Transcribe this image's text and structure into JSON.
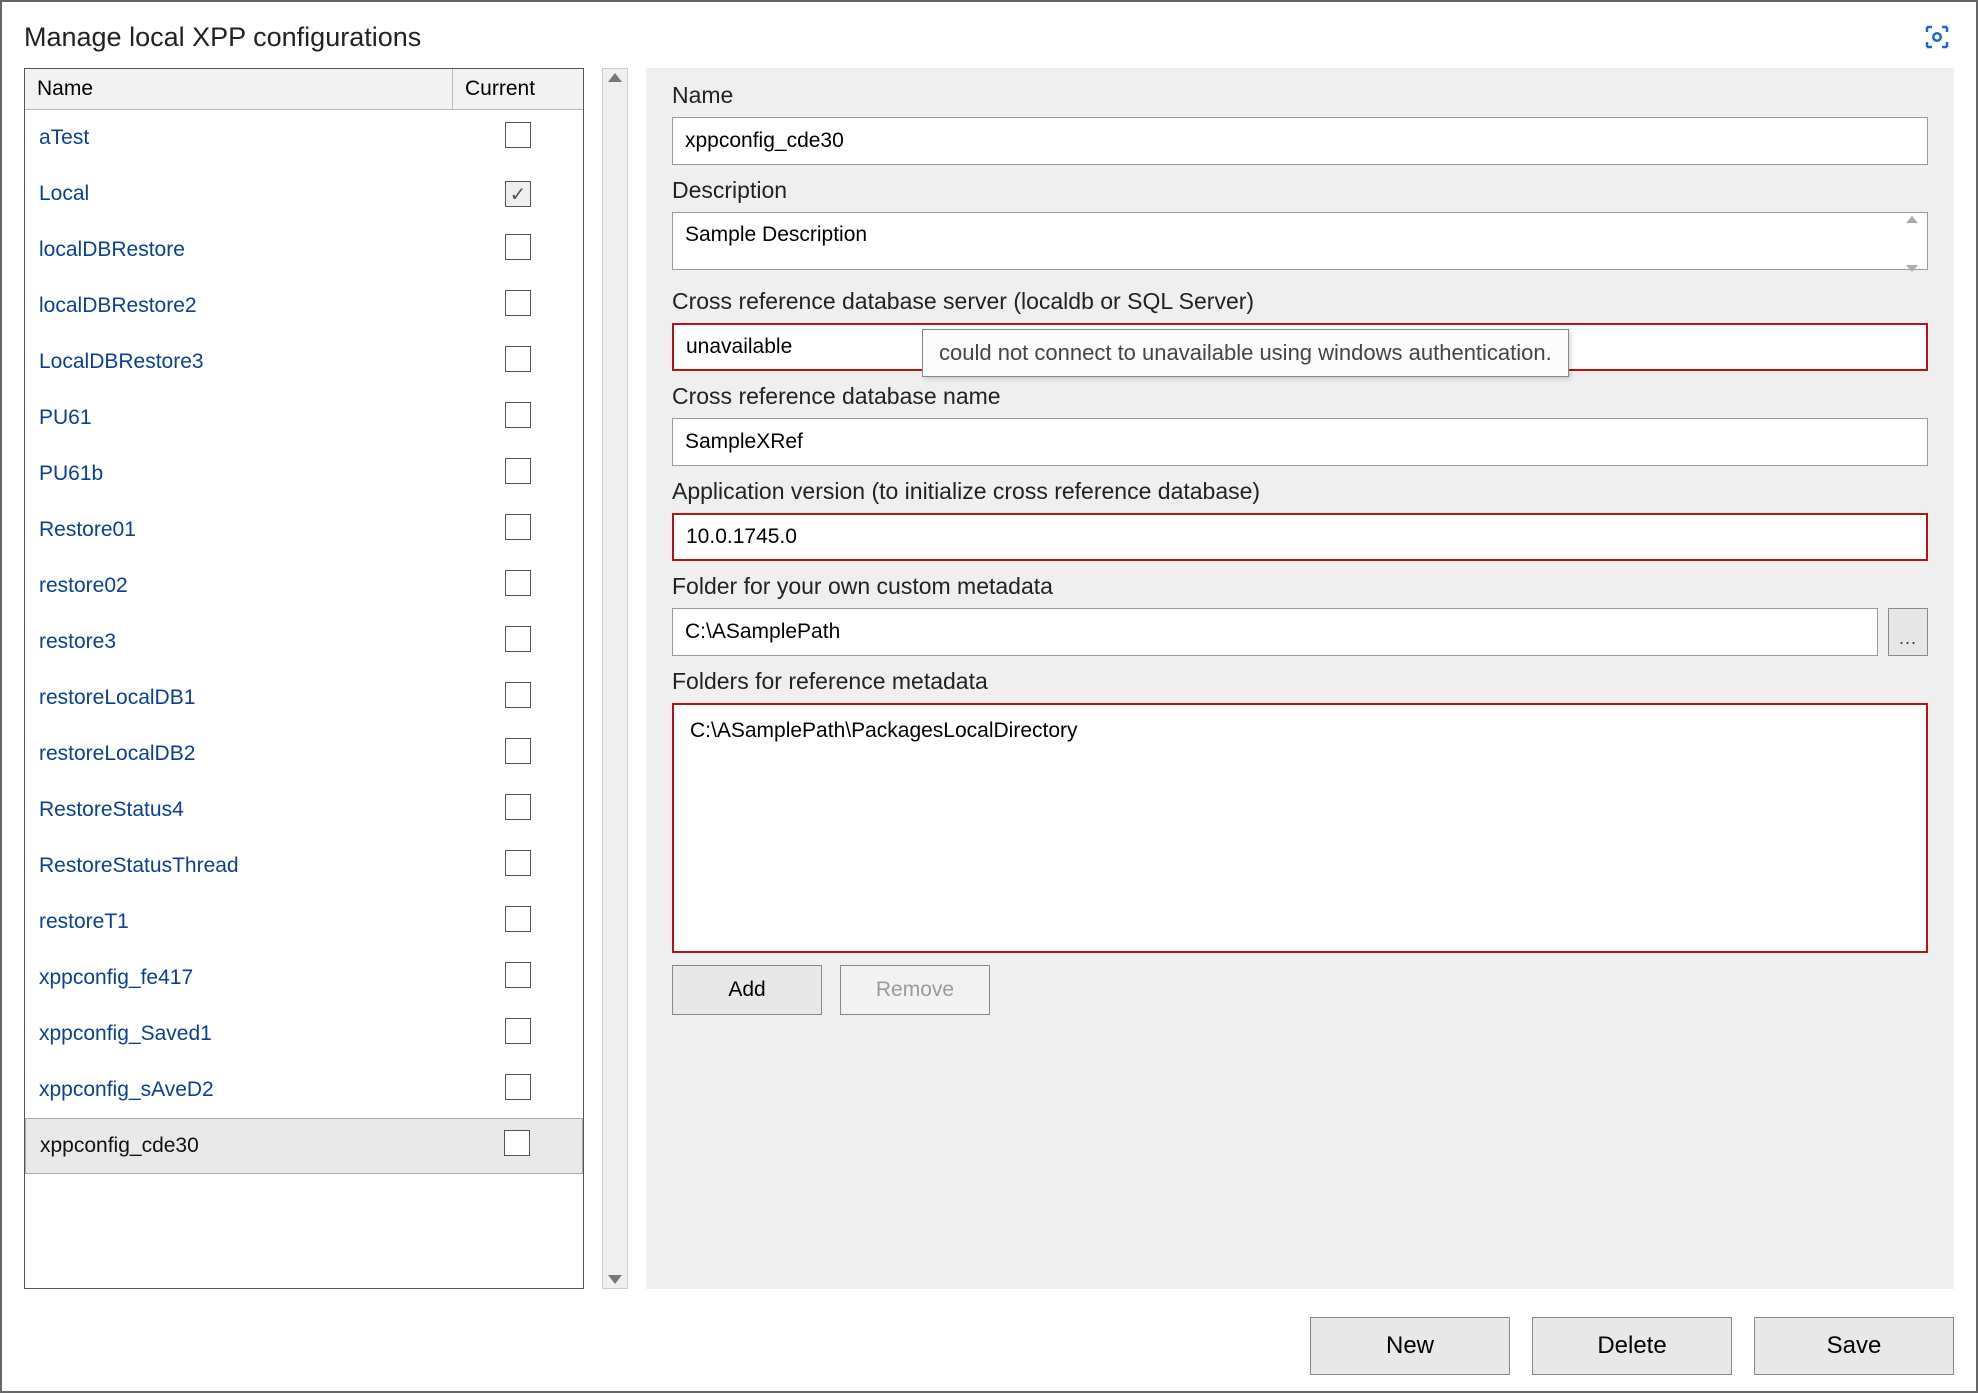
{
  "title": "Manage local XPP configurations",
  "list": {
    "columns": {
      "name": "Name",
      "current": "Current"
    },
    "items": [
      {
        "name": "aTest",
        "current": false,
        "selected": false
      },
      {
        "name": "Local",
        "current": true,
        "selected": false
      },
      {
        "name": "localDBRestore",
        "current": false,
        "selected": false
      },
      {
        "name": "localDBRestore2",
        "current": false,
        "selected": false
      },
      {
        "name": "LocalDBRestore3",
        "current": false,
        "selected": false
      },
      {
        "name": "PU61",
        "current": false,
        "selected": false
      },
      {
        "name": "PU61b",
        "current": false,
        "selected": false
      },
      {
        "name": "Restore01",
        "current": false,
        "selected": false
      },
      {
        "name": "restore02",
        "current": false,
        "selected": false
      },
      {
        "name": "restore3",
        "current": false,
        "selected": false
      },
      {
        "name": "restoreLocalDB1",
        "current": false,
        "selected": false
      },
      {
        "name": "restoreLocalDB2",
        "current": false,
        "selected": false
      },
      {
        "name": "RestoreStatus4",
        "current": false,
        "selected": false
      },
      {
        "name": "RestoreStatusThread",
        "current": false,
        "selected": false
      },
      {
        "name": "restoreT1",
        "current": false,
        "selected": false
      },
      {
        "name": "xppconfig_fe417",
        "current": false,
        "selected": false
      },
      {
        "name": "xppconfig_Saved1",
        "current": false,
        "selected": false
      },
      {
        "name": "xppconfig_sAveD2",
        "current": false,
        "selected": false
      },
      {
        "name": "xppconfig_cde30",
        "current": false,
        "selected": true
      }
    ]
  },
  "form": {
    "name_label": "Name",
    "name_value": "xppconfig_cde30",
    "description_label": "Description",
    "description_value": "Sample Description",
    "xref_server_label": "Cross reference database server (localdb or SQL Server)",
    "xref_server_value": "unavailable",
    "xref_server_tooltip": "could not connect to unavailable using windows authentication.",
    "xref_db_label": "Cross reference database name",
    "xref_db_value": "SampleXRef",
    "app_version_label": "Application version (to initialize cross reference database)",
    "app_version_value": "10.0.1745.0",
    "custom_meta_label": "Folder for your own custom metadata",
    "custom_meta_value": "C:\\ASamplePath",
    "ref_meta_label": "Folders for reference metadata",
    "ref_meta_items": [
      "C:\\ASamplePath\\PackagesLocalDirectory"
    ],
    "add_label": "Add",
    "remove_label": "Remove"
  },
  "buttons": {
    "new": "New",
    "delete": "Delete",
    "save": "Save"
  },
  "browse_ellipsis": "..."
}
